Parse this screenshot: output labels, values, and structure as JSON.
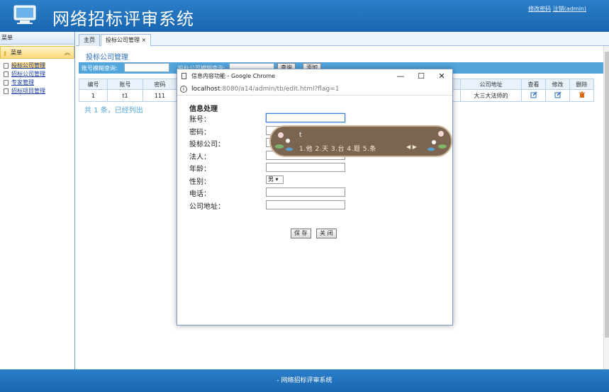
{
  "header": {
    "title": "网络招标评审系统",
    "change_password": "修改密码",
    "logout": "注销(admin)"
  },
  "sidebar": {
    "menu_header": "菜单",
    "panel_title": "菜单",
    "items": [
      {
        "label": "投标公司管理"
      },
      {
        "label": "招标公司管理"
      },
      {
        "label": "专家管理"
      },
      {
        "label": "招标项目管理"
      }
    ]
  },
  "tabs": [
    {
      "label": "主页"
    },
    {
      "label": "投标公司管理 ×"
    }
  ],
  "main": {
    "page_title": "投标公司管理",
    "filter": {
      "account_label": "账号模糊查询:",
      "company_label": "投标公司模糊查询:",
      "query_button": "查询",
      "add_button": "添加"
    },
    "table": {
      "headers": [
        "编号",
        "账号",
        "密码",
        "公司地址",
        "查看",
        "修改",
        "删除"
      ],
      "rows": [
        {
          "id": "1",
          "account": "t1",
          "password": "111",
          "address": "大三大法师的"
        }
      ]
    },
    "summary": "共 1 条，已经列出"
  },
  "dialog": {
    "title": "信息内容功能 - Google Chrome",
    "minimize": "—",
    "maximize": "☐",
    "close": "✕",
    "url_host": "localhost",
    "url_path": ":8080/a14/admin/tb/edit.html?flag=1",
    "form_title": "信息处理",
    "fields": [
      {
        "label": "账号："
      },
      {
        "label": "密码："
      },
      {
        "label": "投标公司："
      },
      {
        "label": "法人："
      },
      {
        "label": "年龄："
      },
      {
        "label": "性别："
      },
      {
        "label": "电话："
      },
      {
        "label": "公司地址："
      }
    ],
    "gender_value": "男",
    "save_button": "保 存",
    "close_button": "关 闭"
  },
  "ime": {
    "input": "t",
    "candidates": "1.他 2.天 3.台 4.题 5.条",
    "nav": "◀ ▶"
  },
  "footer": {
    "text": "- 网络招标评审系统"
  },
  "colors": {
    "header_blue": "#1a66b0",
    "filter_blue": "#52a6dc",
    "delete_orange": "#d86a10"
  }
}
